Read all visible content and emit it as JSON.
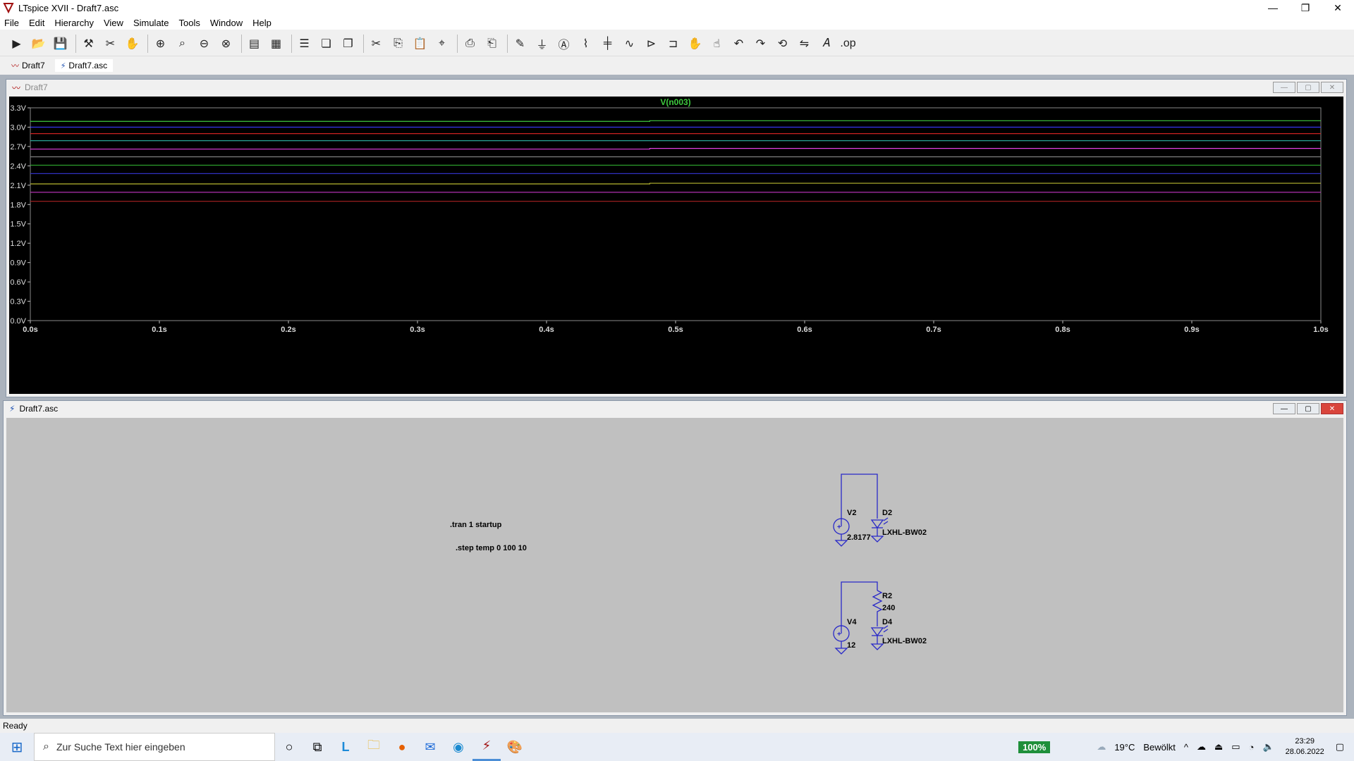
{
  "window": {
    "title": "LTspice XVII - Draft7.asc",
    "controls": [
      "—",
      "❐",
      "✕"
    ]
  },
  "menu": [
    "File",
    "Edit",
    "Hierarchy",
    "View",
    "Simulate",
    "Tools",
    "Window",
    "Help"
  ],
  "tabs": [
    {
      "label": "Draft7"
    },
    {
      "label": "Draft7.asc"
    }
  ],
  "plot": {
    "window_title": "Draft7",
    "trace_label": "V(n003)"
  },
  "chart_data": {
    "type": "line",
    "title": "V(n003)",
    "xlabel": "",
    "ylabel": "",
    "x_ticks": [
      "0.0s",
      "0.1s",
      "0.2s",
      "0.3s",
      "0.4s",
      "0.5s",
      "0.6s",
      "0.7s",
      "0.8s",
      "0.9s",
      "1.0s"
    ],
    "y_ticks": [
      "0.0V",
      "0.3V",
      "0.6V",
      "0.9V",
      "1.2V",
      "1.5V",
      "1.8V",
      "2.1V",
      "2.4V",
      "2.7V",
      "3.0V",
      "3.3V"
    ],
    "xlim": [
      0,
      1
    ],
    "ylim": [
      0,
      3.3
    ],
    "series": [
      {
        "color": "#3ec93e",
        "values": [
          3.09,
          3.1
        ]
      },
      {
        "color": "#3a3aff",
        "values": [
          3.0,
          3.0
        ]
      },
      {
        "color": "#cc2222",
        "values": [
          2.9,
          2.9
        ]
      },
      {
        "color": "#2fb8a8",
        "values": [
          2.79,
          2.79
        ]
      },
      {
        "color": "#e040e0",
        "values": [
          2.66,
          2.67
        ]
      },
      {
        "color": "#888888",
        "values": [
          2.54,
          2.54
        ]
      },
      {
        "color": "#2ea82e",
        "values": [
          2.41,
          2.41
        ]
      },
      {
        "color": "#3030c0",
        "values": [
          2.28,
          2.28
        ]
      },
      {
        "color": "#b8b830",
        "values": [
          2.12,
          2.13
        ]
      },
      {
        "color": "#b030b0",
        "values": [
          1.99,
          1.99
        ]
      },
      {
        "color": "#aa2222",
        "values": [
          1.85,
          1.85
        ]
      }
    ],
    "x": [
      0,
      1
    ],
    "grid": false
  },
  "schematic": {
    "window_title": "Draft7.asc",
    "directives": [
      ".tran 1 startup",
      ".step temp 0 100 10"
    ],
    "components": {
      "v2": {
        "name": "V2",
        "value": "2.8177"
      },
      "d2": {
        "name": "D2",
        "value": "LXHL-BW02"
      },
      "r2": {
        "name": "R2",
        "value": "240"
      },
      "d4": {
        "name": "D4",
        "value": "LXHL-BW02"
      },
      "v4": {
        "name": "V4",
        "value": "12"
      }
    }
  },
  "status": "Ready",
  "taskbar": {
    "search_placeholder": "Zur Suche Text hier eingeben",
    "battery": "100%",
    "weather": "19°C",
    "weather_desc": "Bewölkt",
    "time": "23:29",
    "date": "28.06.2022"
  }
}
